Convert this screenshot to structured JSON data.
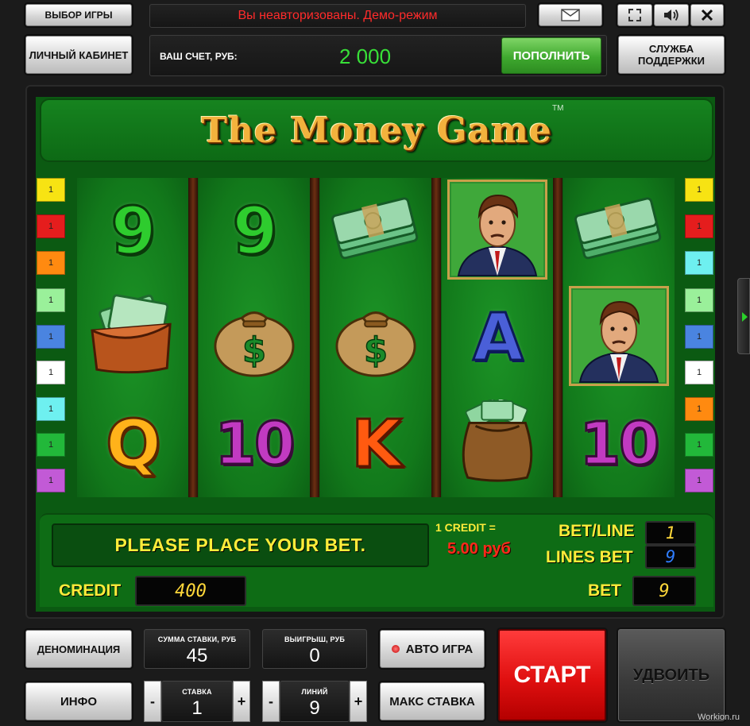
{
  "header": {
    "choose_game": "ВЫБОР ИГРЫ",
    "demo_notice": "Вы неавторизованы. Демо-режим",
    "cabinet": "ЛИЧНЫЙ КАБИНЕТ",
    "account_label": "ВАШ СЧЕТ, РУБ:",
    "account_value": "2 000",
    "deposit": "ПОПОЛНИТЬ",
    "support": "СЛУЖБА ПОДДЕРЖКИ",
    "icons": [
      "mail-icon",
      "fullscreen-icon",
      "sound-icon",
      "close-icon"
    ]
  },
  "game": {
    "title": "The Money Game",
    "trademark": "TM",
    "left_lines": [
      "1",
      "1",
      "1",
      "1",
      "1",
      "1",
      "1",
      "1",
      "1"
    ],
    "right_lines": [
      "1",
      "1",
      "1",
      "1",
      "1",
      "1",
      "1",
      "1",
      "1"
    ],
    "reels": [
      [
        {
          "type": "text",
          "value": "9"
        },
        {
          "type": "icon",
          "value": "wallet-icon"
        },
        {
          "type": "text",
          "value": "Q"
        }
      ],
      [
        {
          "type": "text",
          "value": "9"
        },
        {
          "type": "icon",
          "value": "money-bag-icon"
        },
        {
          "type": "text",
          "value": "10"
        }
      ],
      [
        {
          "type": "icon",
          "value": "cash-stack-icon"
        },
        {
          "type": "icon",
          "value": "money-bag-icon"
        },
        {
          "type": "text",
          "value": "K"
        }
      ],
      [
        {
          "type": "icon",
          "value": "businessman-icon"
        },
        {
          "type": "text",
          "value": "A"
        },
        {
          "type": "icon",
          "value": "cash-sack-icon"
        }
      ],
      [
        {
          "type": "icon",
          "value": "cash-stack-icon"
        },
        {
          "type": "icon",
          "value": "businessman-icon"
        },
        {
          "type": "text",
          "value": "10"
        }
      ]
    ],
    "message": "PLEASE PLACE YOUR BET.",
    "credit_rate_label": "1 CREDIT =",
    "credit_rate_value": "5.00 руб",
    "bet_line_label": "BET/LINE",
    "bet_line_value": "1",
    "lines_bet_label": "LINES BET",
    "lines_bet_value": "9",
    "credit_label": "CREDIT",
    "credit_value": "400",
    "bet_label": "BET",
    "bet_value": "9"
  },
  "controls": {
    "denomination": "ДЕНОМИНАЦИЯ",
    "stake_sum_label": "СУММА СТАВКИ, РУБ",
    "stake_sum_value": "45",
    "win_label": "ВЫИГРЫШ, РУБ",
    "win_value": "0",
    "auto_play": "АВТО ИГРА",
    "start": "СТАРТ",
    "double": "УДВОИТЬ",
    "info": "ИНФО",
    "stake_label": "СТАВКА",
    "stake_value": "1",
    "lines_label": "ЛИНИЙ",
    "lines_value": "9",
    "minus": "-",
    "plus": "+",
    "max_bet": "МАКС СТАВКА"
  },
  "watermark": "Workion.ru",
  "colors": {
    "demo_text": "#ff2b2b",
    "account_value": "#38e038",
    "deposit_green": "#3fa92f",
    "start_red": "#e01010",
    "message_yellow": "#ffec3a",
    "lcd_yellow": "#ffd83a",
    "lcd_blue": "#2f7dff",
    "label_yellow": "#ffec3a",
    "credit_rate_red": "#ff2a1a"
  }
}
